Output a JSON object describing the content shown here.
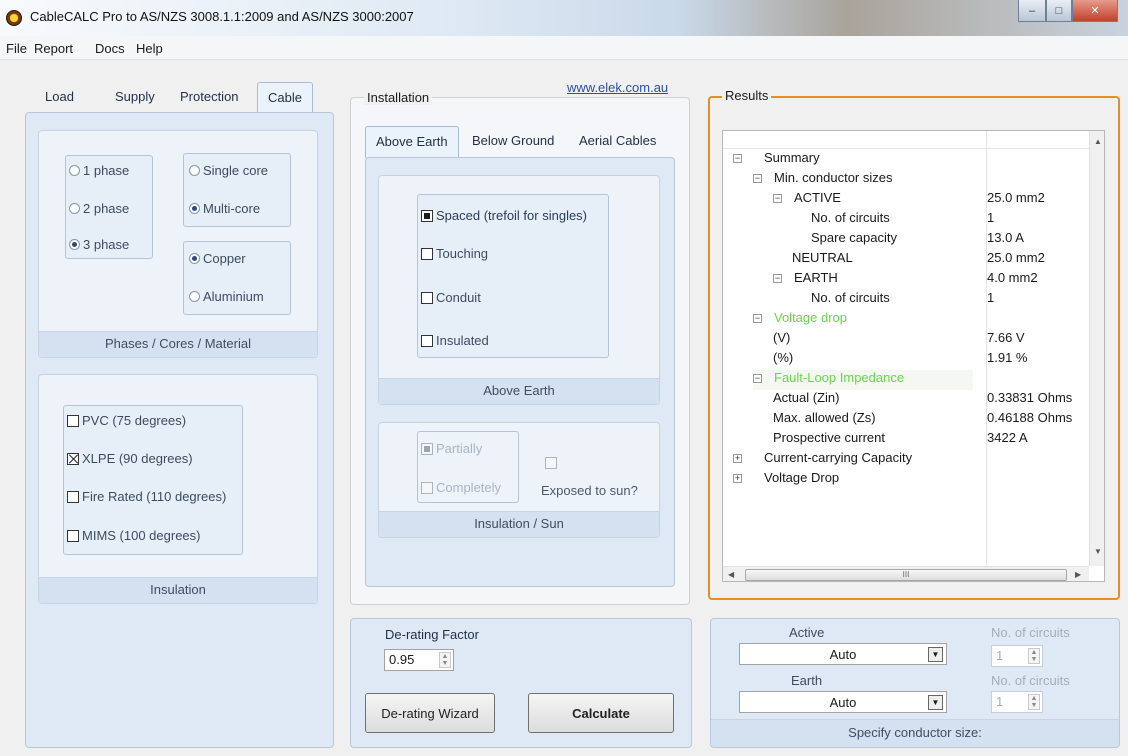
{
  "window": {
    "title": "CableCALC Pro to AS/NZS 3008.1.1:2009 and AS/NZS 3000:2007",
    "controls": [
      "minimize",
      "maximize",
      "close"
    ]
  },
  "menu": [
    "File",
    "Report",
    "Docs",
    "Help"
  ],
  "left_tabs": {
    "items": [
      "Load",
      "Supply",
      "Protection",
      "Cable"
    ],
    "selected": "Cable"
  },
  "phases_panel": {
    "phases": [
      "1 phase",
      "2 phase",
      "3 phase"
    ],
    "phase_selected": "3 phase",
    "cores": [
      "Single core",
      "Multi-core"
    ],
    "core_selected": "Multi-core",
    "materials": [
      "Copper",
      "Aluminium"
    ],
    "material_selected": "Copper",
    "caption": "Phases / Cores / Material"
  },
  "insulation_panel": {
    "options": [
      "PVC (75 degrees)",
      "XLPE (90 degrees)",
      "Fire Rated (110 degrees)",
      "MIMS (100 degrees)"
    ],
    "selected": "XLPE (90 degrees)",
    "caption": "Insulation"
  },
  "installation": {
    "heading": "Installation",
    "link": "www.elek.com.au",
    "tabs": [
      "Above Earth",
      "Below Ground",
      "Aerial Cables"
    ],
    "tab_selected": "Above Earth",
    "options": [
      "Spaced (trefoil for singles)",
      "Touching",
      "Conduit",
      "Insulated"
    ],
    "option_selected": "Spaced (trefoil for singles)",
    "caption": "Above Earth",
    "insulation_sun": {
      "partially": "Partially",
      "completely": "Completely",
      "exposed": "Exposed to sun?",
      "caption": "Insulation / Sun"
    }
  },
  "derating": {
    "label": "De-rating Factor",
    "value": "0.95",
    "wizard_button": "De-rating Wizard",
    "calculate_button": "Calculate"
  },
  "results": {
    "heading": "Results",
    "rows": [
      {
        "label": "Summary",
        "value": ""
      },
      {
        "label": "Min. conductor sizes",
        "value": ""
      },
      {
        "label": "ACTIVE",
        "value": "25.0 mm2"
      },
      {
        "label": "No. of circuits",
        "value": "1"
      },
      {
        "label": "Spare capacity",
        "value": "13.0 A"
      },
      {
        "label": "NEUTRAL",
        "value": "25.0 mm2"
      },
      {
        "label": "EARTH",
        "value": "4.0 mm2"
      },
      {
        "label": "No. of circuits",
        "value": "1"
      },
      {
        "label": "Voltage drop",
        "value": ""
      },
      {
        "label": "(V)",
        "value": "7.66 V"
      },
      {
        "label": "(%)",
        "value": "1.91 %"
      },
      {
        "label": "Fault-Loop Impedance",
        "value": ""
      },
      {
        "label": "Actual (Zin)",
        "value": "0.33831 Ohms"
      },
      {
        "label": "Max. allowed (Zs)",
        "value": "0.46188 Ohms"
      },
      {
        "label": "Prospective current",
        "value": "3422 A"
      },
      {
        "label": "Current-carrying Capacity",
        "value": ""
      },
      {
        "label": "Voltage Drop",
        "value": ""
      }
    ],
    "scroll_mark": "III"
  },
  "conductor": {
    "active_label": "Active",
    "active_value": "Auto",
    "earth_label": "Earth",
    "earth_value": "Auto",
    "circuits_label": "No. of circuits",
    "active_circuits": "1",
    "earth_circuits": "1",
    "caption": "Specify conductor size:"
  }
}
